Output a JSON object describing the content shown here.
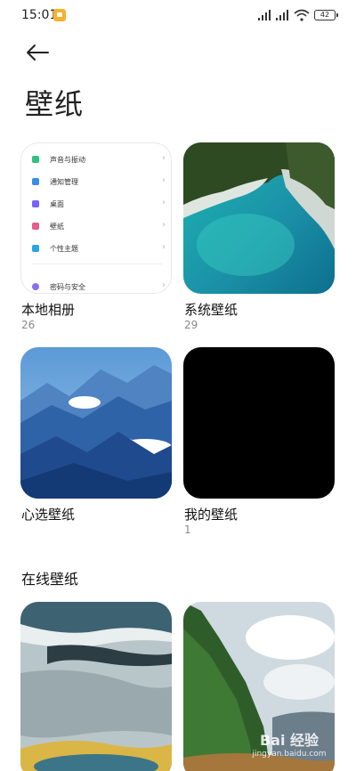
{
  "status_bar": {
    "time": "15:01",
    "battery": "42"
  },
  "header": {
    "title": "壁纸"
  },
  "preview_menu": [
    {
      "label": "声音与振动",
      "color": "#2ec27e"
    },
    {
      "label": "通知管理",
      "color": "#3a8ee6"
    },
    {
      "label": "桌面",
      "color": "#7b61ff"
    },
    {
      "label": "壁纸",
      "color": "#e95b8a"
    },
    {
      "label": "个性主题",
      "color": "#2aa3e8"
    },
    {
      "label": "密码与安全",
      "color": "#8a6cf2"
    }
  ],
  "albums": [
    {
      "label": "本地相册",
      "count": "26"
    },
    {
      "label": "系统壁纸",
      "count": "29"
    },
    {
      "label": "心选壁纸",
      "count": ""
    },
    {
      "label": "我的壁纸",
      "count": "1"
    }
  ],
  "online_section": {
    "title": "在线壁纸"
  },
  "watermark": {
    "line1": "Bai 经验",
    "line2": "jingyan.baidu.com"
  }
}
